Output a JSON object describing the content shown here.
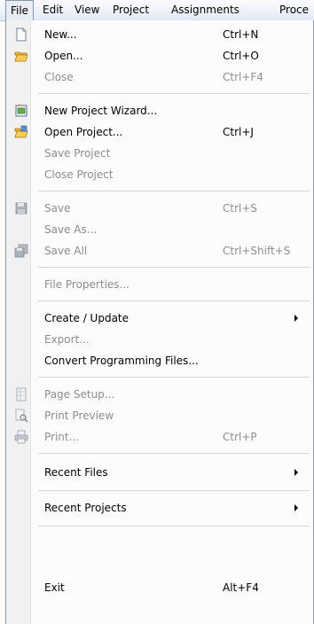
{
  "menubar": {
    "items": [
      "File",
      "Edit",
      "View",
      "Project",
      "Assignments",
      "Proce"
    ]
  },
  "menu": {
    "new": {
      "label": "New...",
      "shortcut": "Ctrl+N"
    },
    "open": {
      "label": "Open...",
      "shortcut": "Ctrl+O"
    },
    "close": {
      "label": "Close",
      "shortcut": "Ctrl+F4"
    },
    "new_project_wizard": {
      "label": "New Project Wizard..."
    },
    "open_project": {
      "label": "Open Project...",
      "shortcut": "Ctrl+J"
    },
    "save_project": {
      "label": "Save Project"
    },
    "close_project": {
      "label": "Close Project"
    },
    "save": {
      "label": "Save",
      "shortcut": "Ctrl+S"
    },
    "save_as": {
      "label": "Save As..."
    },
    "save_all": {
      "label": "Save All",
      "shortcut": "Ctrl+Shift+S"
    },
    "file_properties": {
      "label": "File Properties..."
    },
    "create_update": {
      "label": "Create / Update"
    },
    "export": {
      "label": "Export..."
    },
    "convert_programming_files": {
      "label": "Convert Programming Files..."
    },
    "page_setup": {
      "label": "Page Setup..."
    },
    "print_preview": {
      "label": "Print Preview"
    },
    "print": {
      "label": "Print...",
      "shortcut": "Ctrl+P"
    },
    "recent_files": {
      "label": "Recent Files"
    },
    "recent_projects": {
      "label": "Recent Projects"
    },
    "exit": {
      "label": "Exit",
      "shortcut": "Alt+F4"
    }
  },
  "icons": {
    "new": "new-document-icon",
    "open": "open-folder-icon",
    "new_project_wizard": "project-wizard-icon",
    "open_project": "open-project-icon",
    "save": "save-disk-icon",
    "save_all": "save-all-icon",
    "page_setup": "page-setup-icon",
    "print_preview": "print-preview-icon",
    "print": "printer-icon"
  },
  "colors": {
    "disabled_text": "#8d8d8d",
    "menu_background": "#fcfcfc",
    "gutter": "#f1f1f1",
    "border": "#8b97ab"
  }
}
